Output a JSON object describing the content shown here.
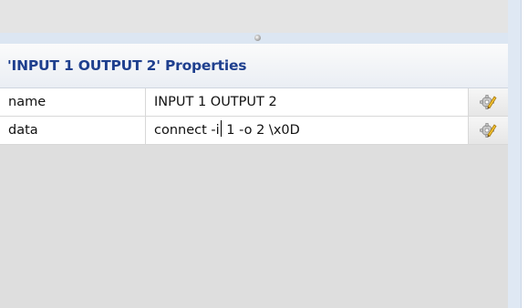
{
  "panel": {
    "title": "'INPUT 1 OUTPUT 2' Properties"
  },
  "properties": [
    {
      "name": "name",
      "value": "INPUT 1 OUTPUT 2",
      "edit_icon": "gear-pencil-icon"
    },
    {
      "name": "data",
      "value_before_caret": "connect -i",
      "value_after_caret": " 1 -o 2 \\x0D",
      "edit_icon": "gear-pencil-icon"
    }
  ],
  "colors": {
    "title_text": "#1e3f8e",
    "panel_background": "#dedede",
    "divider_bar": "#dce6f2"
  }
}
